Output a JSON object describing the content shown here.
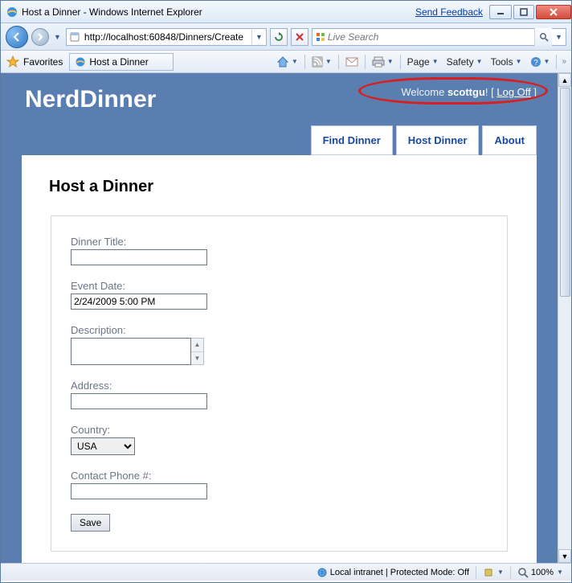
{
  "window": {
    "title": "Host a Dinner - Windows Internet Explorer",
    "feedback": "Send Feedback"
  },
  "address": {
    "url": "http://localhost:60848/Dinners/Create"
  },
  "search": {
    "placeholder": "Live Search"
  },
  "favorites": {
    "label": "Favorites"
  },
  "tab": {
    "title": "Host a Dinner"
  },
  "command": {
    "page": "Page",
    "safety": "Safety",
    "tools": "Tools"
  },
  "app": {
    "brand": "NerdDinner",
    "welcome_prefix": "Welcome ",
    "welcome_user": "scottgu",
    "welcome_bang": "!",
    "logoff_left": " [ ",
    "logoff": "Log Off",
    "logoff_right": " ]",
    "menu": {
      "find": "Find Dinner",
      "host": "Host Dinner",
      "about": "About"
    },
    "page_title": "Host a Dinner",
    "form": {
      "title_label": "Dinner Title:",
      "title_value": "",
      "date_label": "Event Date:",
      "date_value": "2/24/2009 5:00 PM",
      "desc_label": "Description:",
      "desc_value": "",
      "address_label": "Address:",
      "address_value": "",
      "country_label": "Country:",
      "country_value": "USA",
      "phone_label": "Contact Phone #:",
      "phone_value": "",
      "save": "Save"
    }
  },
  "status": {
    "zone": "Local intranet | Protected Mode: Off",
    "zoom": "100%"
  }
}
